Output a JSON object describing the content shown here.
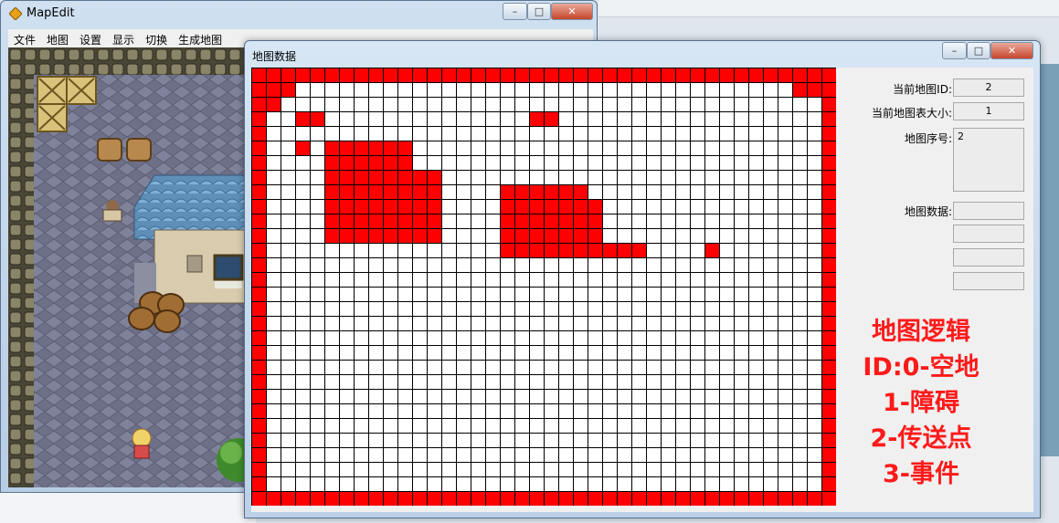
{
  "mapedit": {
    "title": "MapEdit",
    "menu": [
      "文件",
      "地图",
      "设置",
      "显示",
      "切换",
      "生成地图"
    ]
  },
  "datawin": {
    "title": "地图数据",
    "fields": {
      "current_map_id_label": "当前地图ID:",
      "current_map_id_value": "2",
      "table_size_label": "当前地图表大小:",
      "table_size_value": "1",
      "map_index_label": "地图序号:",
      "map_index_value": "2",
      "map_data_label": "地图数据:",
      "map_data_values": [
        "",
        "",
        "",
        ""
      ]
    },
    "legend": [
      "地图逻辑",
      "ID:0-空地",
      "1-障碍",
      "2-传送点",
      "3-事件"
    ]
  },
  "colors": {
    "empty": "#ffffff",
    "obstacle": "#ff0000",
    "teleport": "#0000ff",
    "event": "#ff00ff",
    "grid_line": "#000000"
  },
  "map_grid": {
    "rows": 30,
    "cols": 40,
    "cells": [
      "1111111111111111111111111111111111111111",
      "1110000000000000000000000000000000000111",
      "1100000000000000000000000000000000000001",
      "1001100000000000000110000000000000000001",
      "1000000000000000000000000000000000000001",
      "1001011111100000000000000000000000000001",
      "1000011111100000000000000000000000000001",
      "1000011111111000000000000000000000000001",
      "1000011111111000011111100000000000000001",
      "1000011111111000011111110000000000000001",
      "1000011111111000011111110000000000000001",
      "1000011111111000011111110000000000000001",
      "1000000000000000011111111110000100000001",
      "1000000000000000000000000000000000000001",
      "1000000000000000000000000000000000000001",
      "1000000000000000000000000000000000000001",
      "1000000000000000000000000000000000000001",
      "1000000000000000000000000000000000000001",
      "1000000000000000000000000000000000000001",
      "1000000000000000000000000000000000000001",
      "1000000000000000000000000000000000000001",
      "1000000000000000000000000000000000000001",
      "1000000000000000000000000000000000000001",
      "1000000000000000000000000000000000000001",
      "1000000000000000000000000000000000000001",
      "1000000000000000000000000000000000000001",
      "1000000000000000000000000000000000000001",
      "1000000000000000000000000000000000000001",
      "1000000000000000000000000000000000000001",
      "1111111111111111111111111111111111111111"
    ]
  }
}
